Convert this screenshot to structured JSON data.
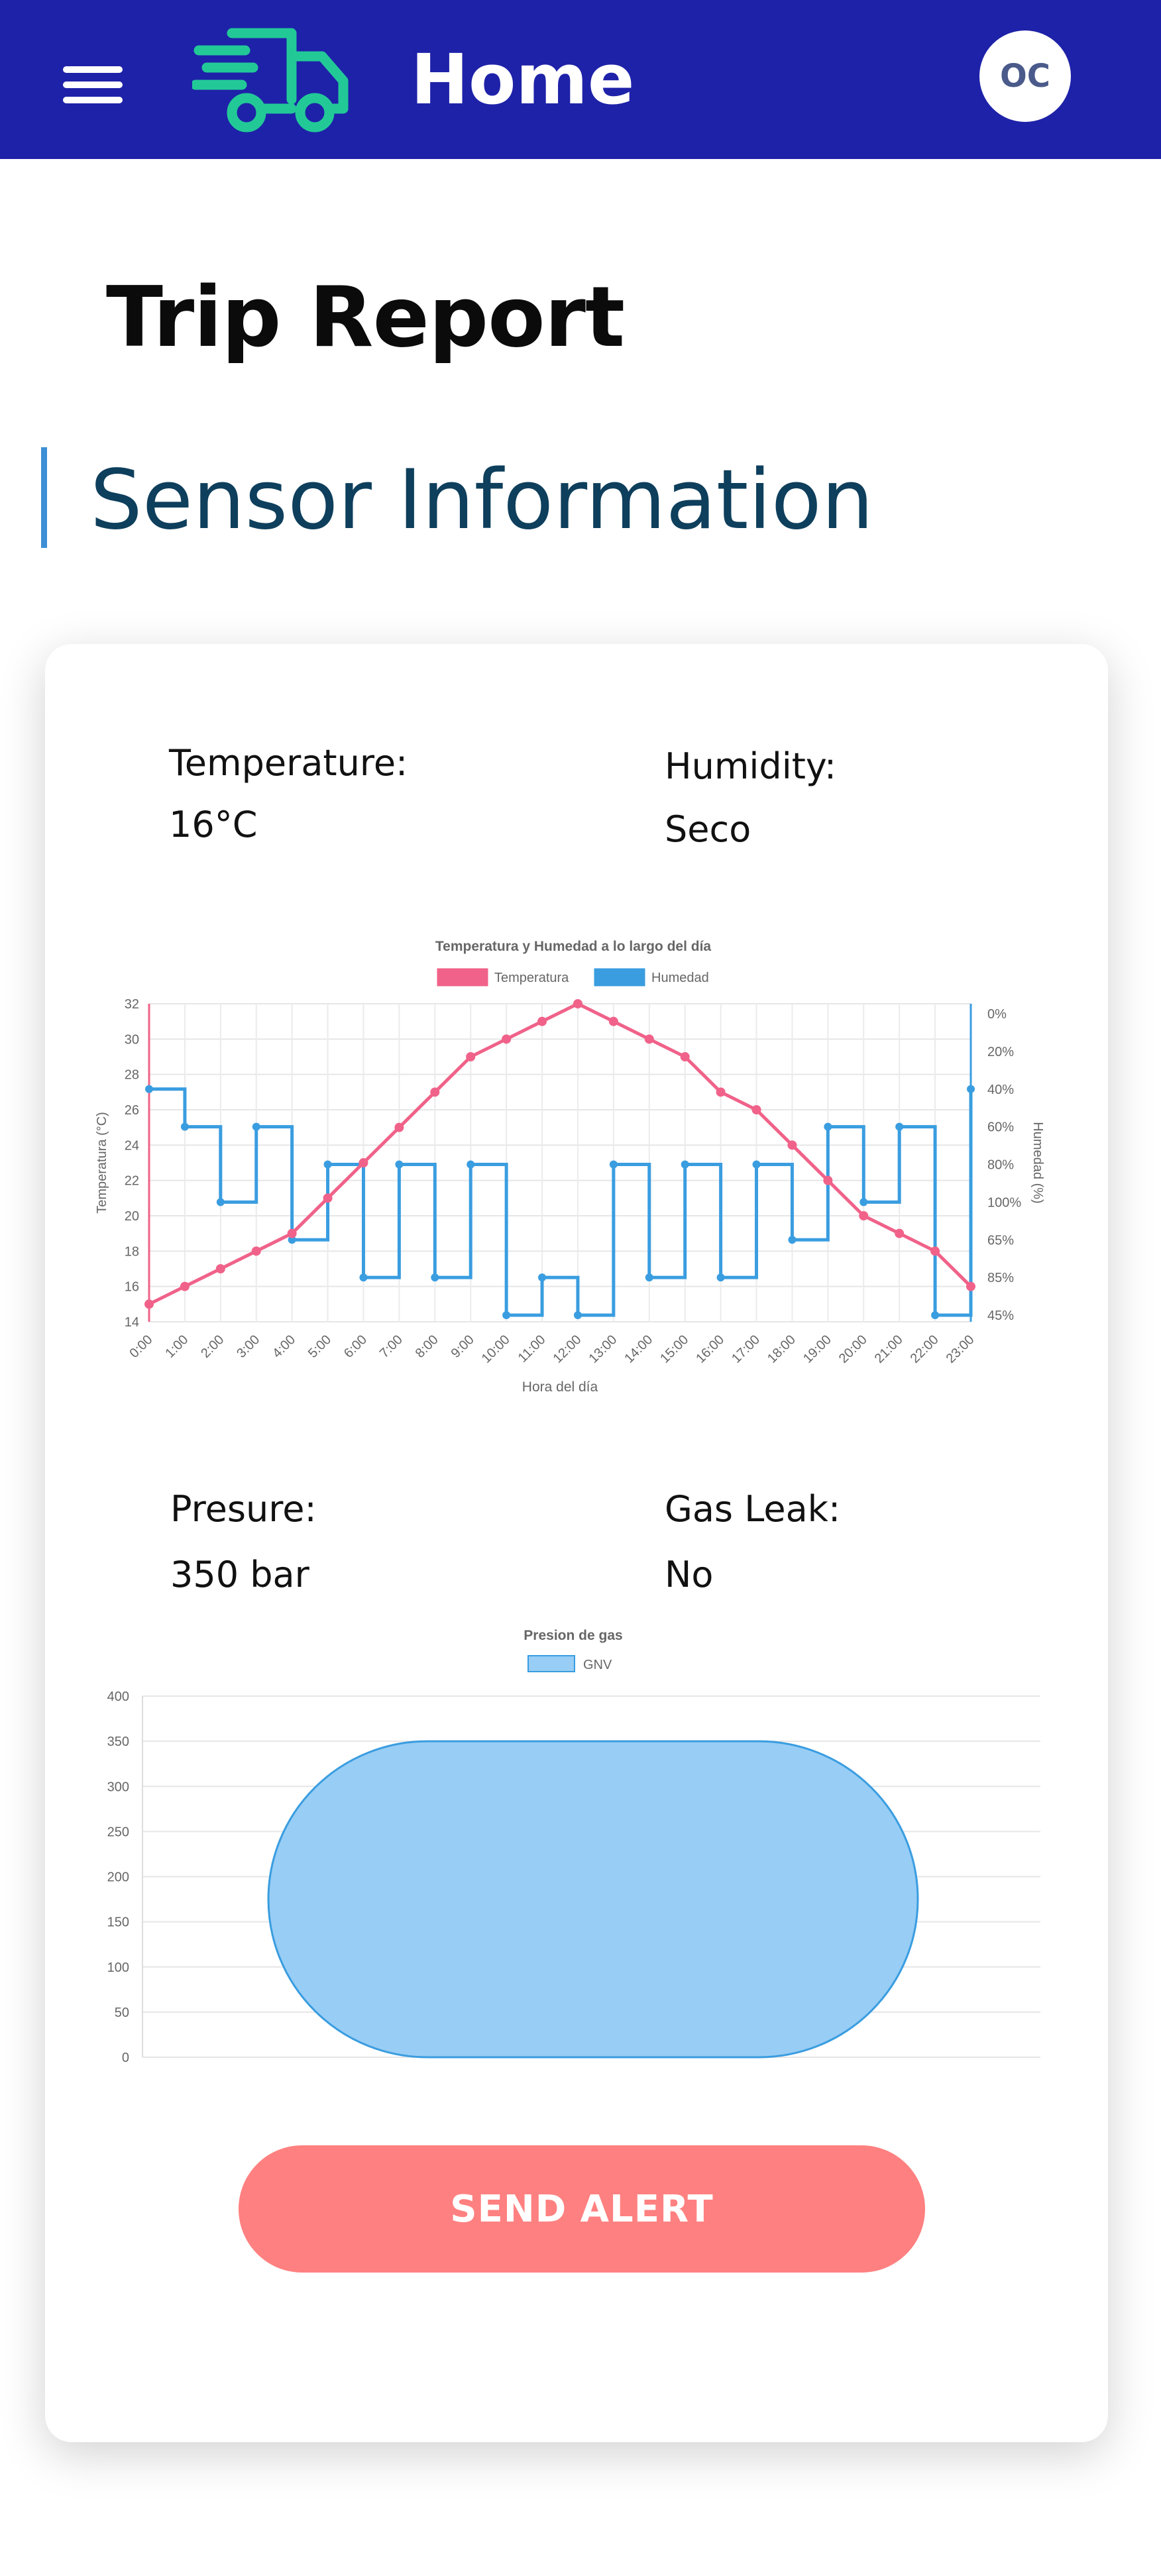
{
  "header": {
    "title": "Home",
    "avatar_initials": "OC",
    "menu_icon": "hamburger-menu-icon",
    "logo_icon": "delivery-truck-icon"
  },
  "page": {
    "title": "Trip Report",
    "section_title": "Sensor Information"
  },
  "sensors": {
    "temperature_label": "Temperature:",
    "temperature_value": "16°C",
    "humidity_label": "Humidity:",
    "humidity_value": "Seco",
    "pressure_label": "Presure:",
    "pressure_value": "350 bar",
    "gas_leak_label": "Gas Leak:",
    "gas_leak_value": "No"
  },
  "actions": {
    "send_alert_label": "SEND ALERT"
  },
  "colors": {
    "header_bg": "#1e22a8",
    "temperature_line": "#f06289",
    "humidity_line": "#3a9de0",
    "gnv_fill": "#98cdf5",
    "alert_button": "#ff8080"
  },
  "chart_data": [
    {
      "type": "line",
      "title": "Temperatura y Humedad a lo largo del día",
      "xlabel": "Hora del día",
      "ylabel": "Temperatura (°C)",
      "y2label": "Humedad (%)",
      "legend": "top-center",
      "grid": true,
      "categories": [
        "0:00",
        "1:00",
        "2:00",
        "3:00",
        "4:00",
        "5:00",
        "6:00",
        "7:00",
        "8:00",
        "9:00",
        "10:00",
        "11:00",
        "12:00",
        "13:00",
        "14:00",
        "15:00",
        "16:00",
        "17:00",
        "18:00",
        "19:00",
        "20:00",
        "21:00",
        "22:00",
        "23:00"
      ],
      "ylim": [
        14,
        32
      ],
      "yticks": [
        "32",
        "30",
        "28",
        "26",
        "24",
        "22",
        "20",
        "18",
        "16",
        "14"
      ],
      "y2ticks": [
        "0%",
        "20%",
        "40%",
        "60%",
        "80%",
        "100%",
        "65%",
        "85%",
        "45%"
      ],
      "series": [
        {
          "name": "Temperatura",
          "axis": "left",
          "step": false,
          "values": [
            15,
            16,
            17,
            18,
            19,
            21,
            23,
            25,
            27,
            29,
            30,
            31,
            32,
            31,
            30,
            29,
            27,
            26,
            24,
            22,
            20,
            19,
            18,
            16
          ]
        },
        {
          "name": "Humedad",
          "axis": "right",
          "step": true,
          "values": [
            "40%",
            "60%",
            "100%",
            "60%",
            "65%",
            "80%",
            "85%",
            "80%",
            "85%",
            "80%",
            "45%",
            "85%",
            "45%",
            "80%",
            "85%",
            "80%",
            "85%",
            "80%",
            "65%",
            "60%",
            "100%",
            "60%",
            "45%",
            "40%"
          ]
        }
      ]
    },
    {
      "type": "bar",
      "title": "Presion de gas",
      "legend": "top-center",
      "grid": true,
      "categories": [
        ""
      ],
      "ylim": [
        0,
        400
      ],
      "yticks": [
        "400",
        "350",
        "300",
        "250",
        "200",
        "150",
        "100",
        "50",
        "0"
      ],
      "series": [
        {
          "name": "GNV",
          "values": [
            350
          ]
        }
      ]
    }
  ]
}
